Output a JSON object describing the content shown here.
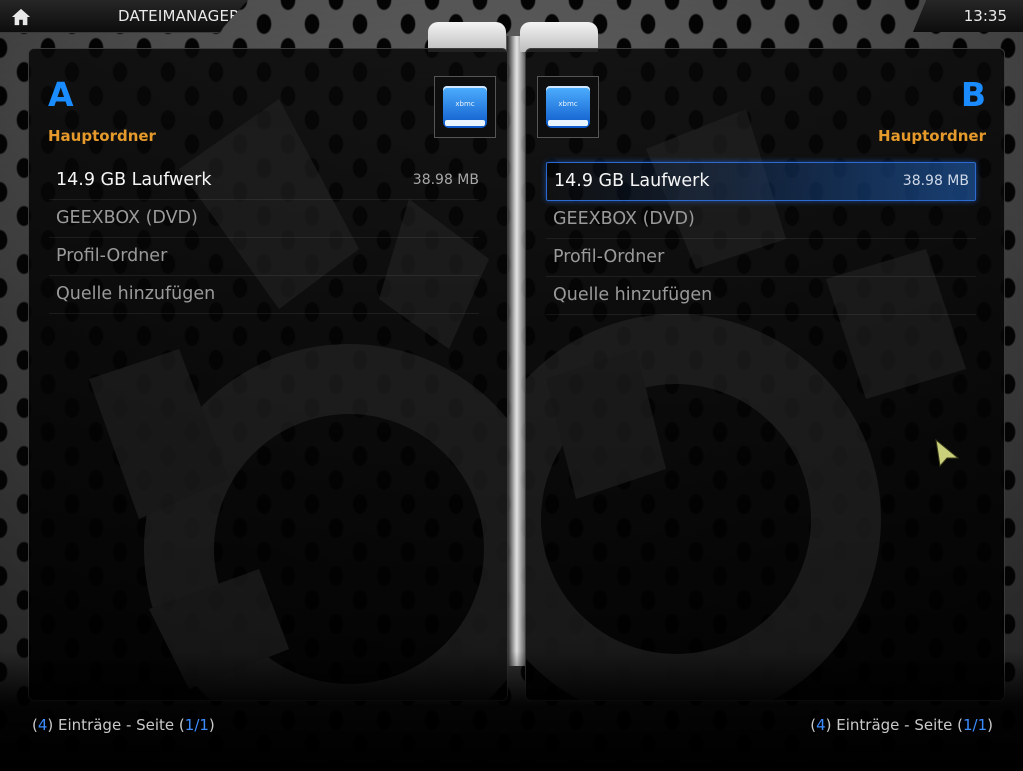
{
  "header": {
    "title": "DATEIMANAGER",
    "clock": "13:35"
  },
  "panels": [
    {
      "letter": "A",
      "folder": "Hauptordner",
      "thumb_text": "xbmc",
      "items": [
        {
          "label": "14.9 GB Laufwerk",
          "size": "38.98 MB"
        },
        {
          "label": "GEEXBOX (DVD)",
          "size": ""
        },
        {
          "label": "Profil-Ordner",
          "size": ""
        },
        {
          "label": "Quelle hinzufügen",
          "size": ""
        }
      ],
      "footer": {
        "count": "4",
        "mid": "Einträge - Seite",
        "page": "1/1"
      }
    },
    {
      "letter": "B",
      "folder": "Hauptordner",
      "thumb_text": "xbmc",
      "items": [
        {
          "label": "14.9 GB Laufwerk",
          "size": "38.98 MB"
        },
        {
          "label": "GEEXBOX (DVD)",
          "size": ""
        },
        {
          "label": "Profil-Ordner",
          "size": ""
        },
        {
          "label": "Quelle hinzufügen",
          "size": ""
        }
      ],
      "footer": {
        "count": "4",
        "mid": "Einträge - Seite",
        "page": "1/1"
      }
    }
  ],
  "colors": {
    "accent_blue": "#1a8cff",
    "folder_orange": "#e59a2b",
    "selection_blue": "#2c6ad0"
  },
  "icons": {
    "home": "home-icon",
    "drive": "drive-icon",
    "cursor": "mouse-pointer-icon"
  }
}
